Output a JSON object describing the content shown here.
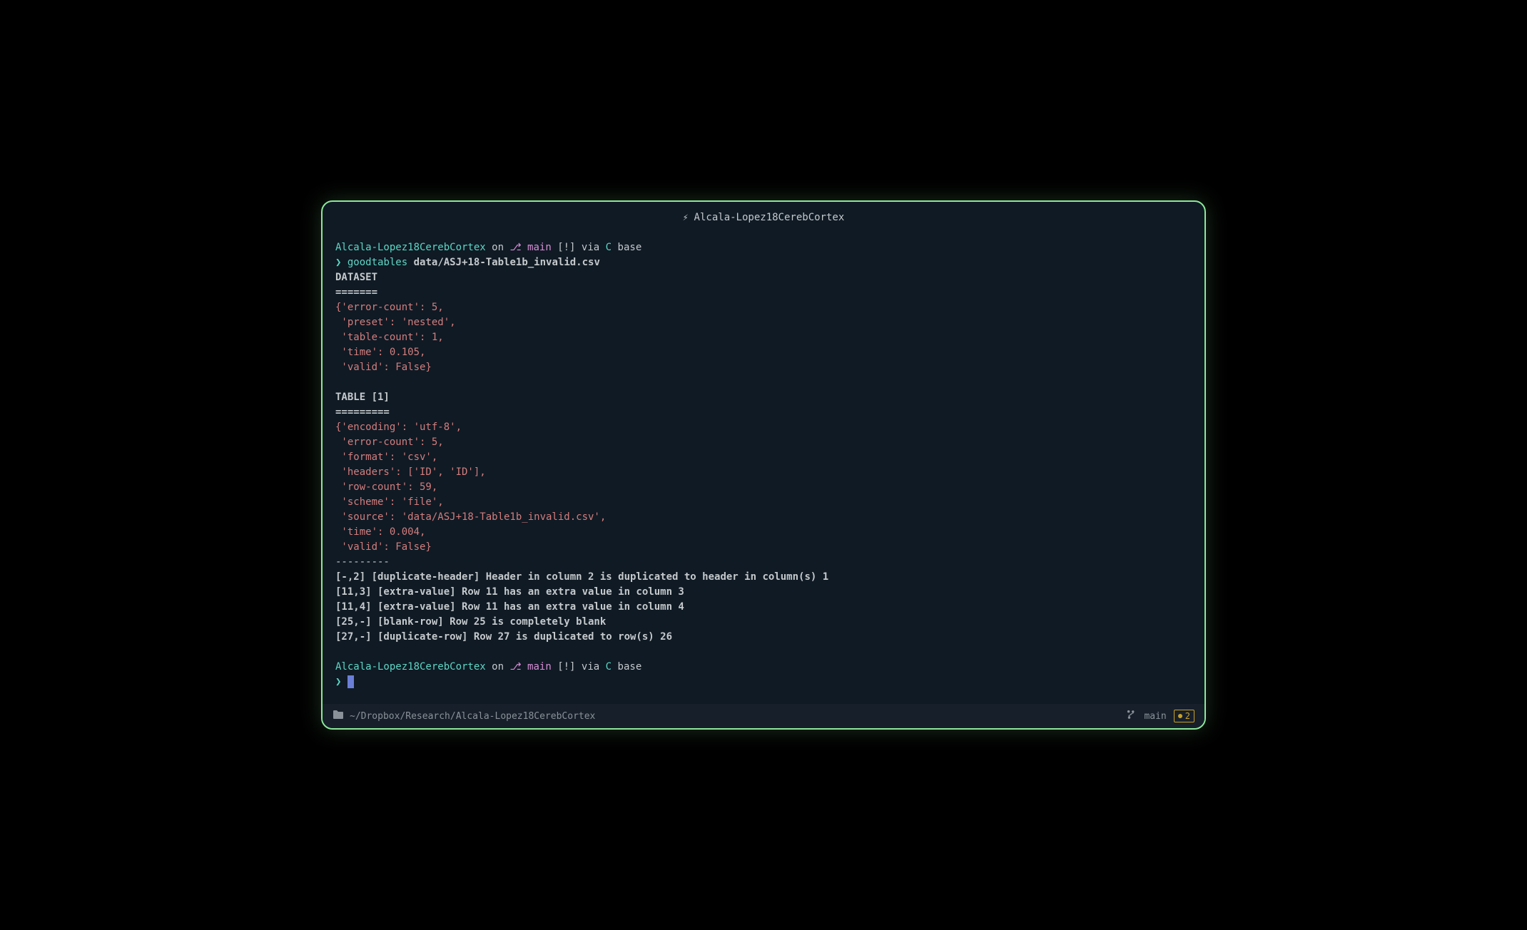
{
  "titlebar": {
    "icon": "⚡",
    "title": "Alcala-Lopez18CerebCortex"
  },
  "prompt1": {
    "dir": "Alcala-Lopez18CerebCortex",
    "on": "on",
    "branch_icon": "⎇",
    "branch": "main",
    "modified": "[!]",
    "via": "via",
    "conda_symbol": "C",
    "conda_env": "base"
  },
  "command1": {
    "arrow": "❯",
    "cmd": "goodtables",
    "arg": "data/ASJ+18-Table1b_invalid.csv"
  },
  "output": {
    "dataset_header": "DATASET",
    "dataset_equals": "=======",
    "dataset_dict_l1": "{'error-count': 5,",
    "dataset_dict_l2": " 'preset': 'nested',",
    "dataset_dict_l3": " 'table-count': 1,",
    "dataset_dict_l4": " 'time': 0.105,",
    "dataset_dict_l5": " 'valid': False}",
    "table_header": "TABLE [1]",
    "table_equals": "=========",
    "table_dict_l1": "{'encoding': 'utf-8',",
    "table_dict_l2": " 'error-count': 5,",
    "table_dict_l3": " 'format': 'csv',",
    "table_dict_l4": " 'headers': ['ID', 'ID'],",
    "table_dict_l5": " 'row-count': 59,",
    "table_dict_l6": " 'scheme': 'file',",
    "table_dict_l7": " 'source': 'data/ASJ+18-Table1b_invalid.csv',",
    "table_dict_l8": " 'time': 0.004,",
    "table_dict_l9": " 'valid': False}",
    "dashes": "---------",
    "err1": "[-,2] [duplicate-header] Header in column 2 is duplicated to header in column(s) 1",
    "err2": "[11,3] [extra-value] Row 11 has an extra value in column 3",
    "err3": "[11,4] [extra-value] Row 11 has an extra value in column 4",
    "err4": "[25,-] [blank-row] Row 25 is completely blank",
    "err5": "[27,-] [duplicate-row] Row 27 is duplicated to row(s) 26"
  },
  "prompt2": {
    "dir": "Alcala-Lopez18CerebCortex",
    "on": "on",
    "branch_icon": "⎇",
    "branch": "main",
    "modified": "[!]",
    "via": "via",
    "conda_symbol": "C",
    "conda_env": "base",
    "arrow": "❯"
  },
  "statusbar": {
    "folder_icon": "📁",
    "path": "~/Dropbox/Research/Alcala-Lopez18CerebCortex",
    "git_icon": "⎇",
    "branch": "main",
    "sync_count": "2"
  }
}
